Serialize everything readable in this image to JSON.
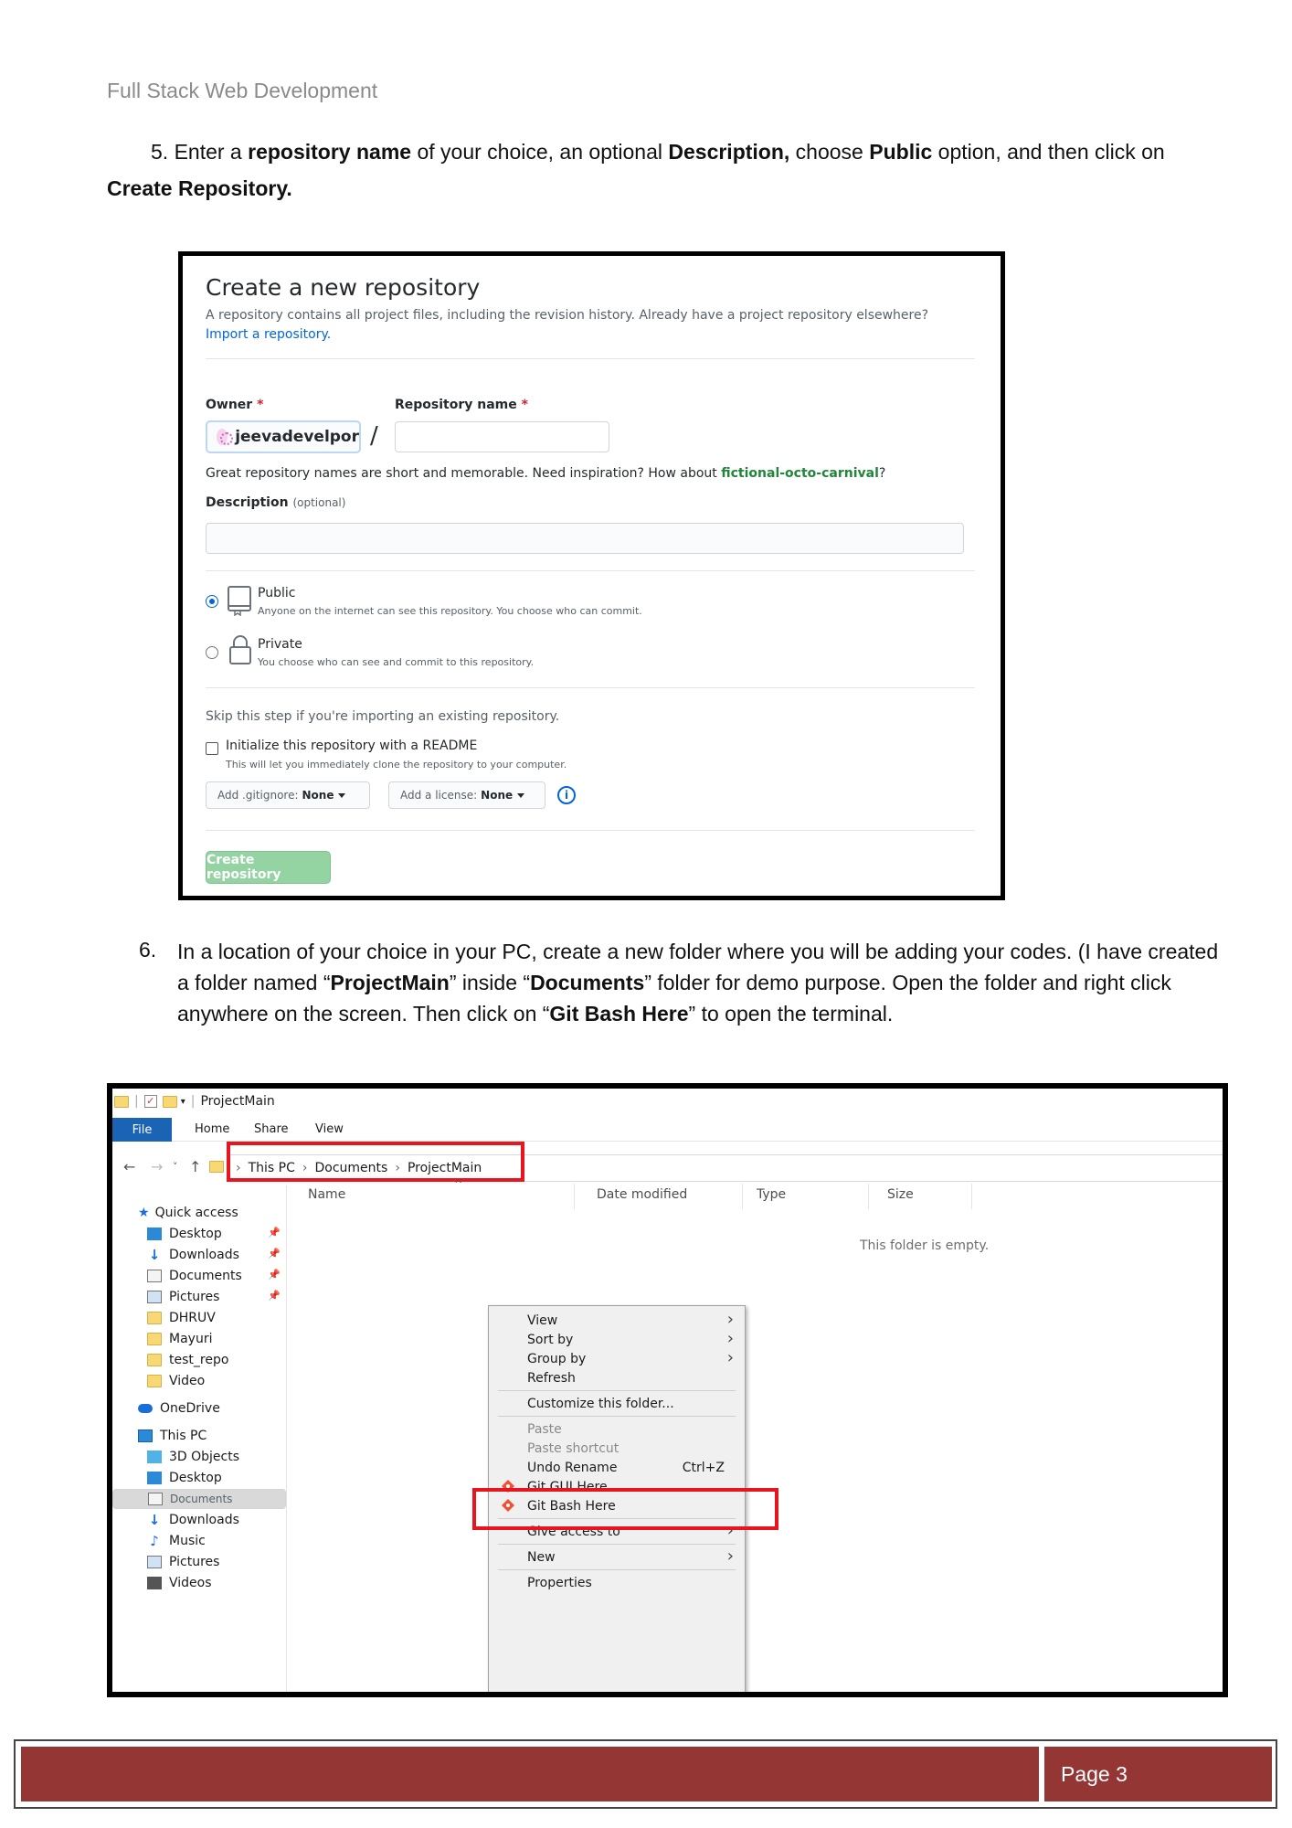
{
  "header": {
    "title": "Full Stack Web Development"
  },
  "step5": {
    "p1": "5. Enter a ",
    "b1": "repository name",
    "p2": " of your choice, an optional ",
    "b2": "Description,",
    "p3": " choose ",
    "b3": "Public",
    "p4": " option, and then click on ",
    "b4": "Create Repository."
  },
  "github": {
    "title": "Create a new repository",
    "subtitle": "A repository contains all project files, including the revision history. Already have a project repository elsewhere?",
    "import_link": "Import a repository.",
    "owner_label": "Owner",
    "required_mark": "*",
    "repo_name_label": "Repository name",
    "owner_value": "jeevadevelpor",
    "slash": "/",
    "hint_prefix": "Great repository names are short and memorable. Need inspiration? How about ",
    "hint_suggestion": "fictional-octo-carnival",
    "hint_suffix": "?",
    "description_label": "Description",
    "optional": "(optional)",
    "public_title": "Public",
    "public_desc": "Anyone on the internet can see this repository. You choose who can commit.",
    "private_title": "Private",
    "private_desc": "You choose who can see and commit to this repository.",
    "skip_text": "Skip this step if you're importing an existing repository.",
    "init_title": "Initialize this repository with a README",
    "init_desc": "This will let you immediately clone the repository to your computer.",
    "gitignore_label": "Add .gitignore:",
    "gitignore_value": "None",
    "license_label": "Add a license:",
    "license_value": "None",
    "info_glyph": "i",
    "create_button": "Create repository"
  },
  "step6": {
    "num": "6.",
    "p1": "In a location of your choice in your PC, create a new folder where you will be adding your codes. (I have created a folder named “",
    "b1": "ProjectMain",
    "p2": "” inside “",
    "b2": "Documents",
    "p3": "” folder for demo purpose. Open the folder and right click anywhere on the screen. Then click on “",
    "b3": "Git Bash Here",
    "p4": "” to open the terminal."
  },
  "explorer": {
    "window_title": "ProjectMain",
    "ribbon": {
      "file": "File",
      "home": "Home",
      "share": "Share",
      "view": "View"
    },
    "breadcrumb": [
      "This PC",
      "Documents",
      "ProjectMain"
    ],
    "crumb_sep": "›",
    "columns": [
      "Name",
      "Date modified",
      "Type",
      "Size"
    ],
    "empty_text": "This folder is empty.",
    "nav": {
      "quick_access": "Quick access",
      "quick_items": [
        "Desktop",
        "Downloads",
        "Documents",
        "Pictures",
        "DHRUV",
        "Mayuri",
        "test_repo",
        "Video"
      ],
      "onedrive": "OneDrive",
      "this_pc": "This PC",
      "pc_items": [
        "3D Objects",
        "Desktop",
        "Documents",
        "Downloads",
        "Music",
        "Pictures",
        "Videos"
      ]
    },
    "context_menu": {
      "view": "View",
      "sort_by": "Sort by",
      "group_by": "Group by",
      "refresh": "Refresh",
      "customize": "Customize this folder...",
      "paste": "Paste",
      "paste_shortcut": "Paste shortcut",
      "undo_rename": "Undo Rename",
      "undo_shortcut": "Ctrl+Z",
      "git_gui": "Git GUI Here",
      "git_bash": "Git Bash Here",
      "give_access": "Give access to",
      "new": "New",
      "properties": "Properties"
    }
  },
  "footer": {
    "page": "Page 3"
  },
  "colors": {
    "footer_bar": "#943634",
    "highlight_red": "#e8141e",
    "github_green_button": "#94d3a2",
    "file_tab_blue": "#1a63b5"
  }
}
